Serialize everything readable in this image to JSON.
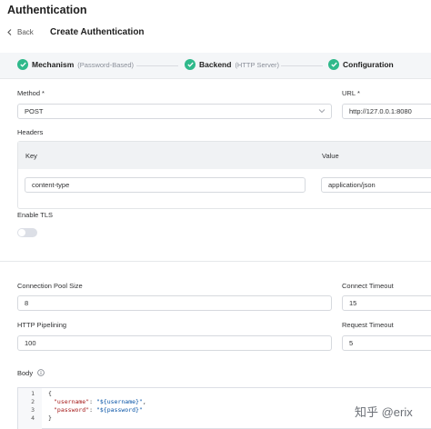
{
  "page": {
    "title": "Authentication"
  },
  "breadcrumb": {
    "back_label": "Back",
    "title": "Create Authentication"
  },
  "steps": [
    {
      "title": "Mechanism",
      "subtitle": "(Password-Based)"
    },
    {
      "title": "Backend",
      "subtitle": "(HTTP Server)"
    },
    {
      "title": "Configuration",
      "subtitle": ""
    }
  ],
  "form": {
    "method": {
      "label": "Method",
      "required_mark": "*",
      "value": "POST"
    },
    "url": {
      "label": "URL",
      "required_mark": "*",
      "value": "http://127.0.0.1:8080"
    },
    "headers": {
      "label": "Headers",
      "columns": [
        "Key",
        "Value"
      ],
      "rows": [
        {
          "key": "content-type",
          "value": "application/json"
        }
      ]
    },
    "enable_tls": {
      "label": "Enable TLS",
      "enabled": false
    },
    "pool_size": {
      "label": "Connection Pool Size",
      "value": "8"
    },
    "connect_timeout": {
      "label": "Connect Timeout",
      "value": "15"
    },
    "pipelining": {
      "label": "HTTP Pipelining",
      "value": "100"
    },
    "request_timeout": {
      "label": "Request Timeout",
      "value": "5"
    },
    "body": {
      "label": "Body",
      "line_numbers": [
        "1",
        "2",
        "3",
        "4"
      ],
      "lines": {
        "l1": "{",
        "l2_key": "\"username\"",
        "l2_val": "\"${username}\"",
        "l3_key": "\"password\"",
        "l3_val": "\"${password}\"",
        "l4": "}"
      }
    }
  },
  "watermark": "知乎 @erix",
  "colors": {
    "accent": "#2fb98b",
    "steps_bg": "#f4f6f8",
    "header_bg": "#f0f2f4"
  }
}
